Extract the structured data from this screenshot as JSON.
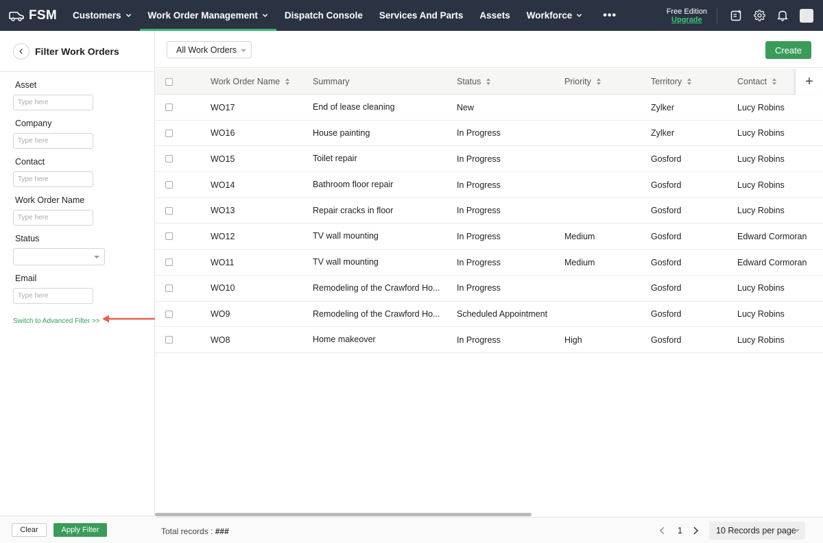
{
  "brand": {
    "name": "FSM"
  },
  "nav": {
    "items": [
      {
        "label": "Customers",
        "dropdown": true,
        "active": false
      },
      {
        "label": "Work Order Management",
        "dropdown": true,
        "active": true
      },
      {
        "label": "Dispatch Console",
        "dropdown": false,
        "active": false
      },
      {
        "label": "Services And Parts",
        "dropdown": false,
        "active": false
      },
      {
        "label": "Assets",
        "dropdown": false,
        "active": false
      },
      {
        "label": "Workforce",
        "dropdown": true,
        "active": false
      }
    ],
    "more": "•••",
    "edition": "Free Edition",
    "upgrade": "Upgrade",
    "icons": [
      "add-note-icon",
      "gear-icon",
      "bell-icon",
      "avatar"
    ]
  },
  "filter": {
    "title": "Filter Work Orders",
    "fields": [
      {
        "label": "Asset",
        "placeholder": "Type here",
        "type": "text"
      },
      {
        "label": "Company",
        "placeholder": "Type here",
        "type": "text"
      },
      {
        "label": "Contact",
        "placeholder": "Type here",
        "type": "text"
      },
      {
        "label": "Work Order Name",
        "placeholder": "Type here",
        "type": "text"
      },
      {
        "label": "Status",
        "placeholder": "",
        "type": "select"
      },
      {
        "label": "Email",
        "placeholder": "Type here",
        "type": "text"
      }
    ],
    "advanced_link": "Switch to Advanced Filter >>",
    "clear_label": "Clear",
    "apply_label": "Apply Filter"
  },
  "toolbar": {
    "view": "All Work Orders",
    "create_label": "Create"
  },
  "table": {
    "columns": [
      "Work Order Name",
      "Summary",
      "Status",
      "Priority",
      "Territory",
      "Contact"
    ],
    "rows": [
      [
        "WO17",
        "End of lease cleaning",
        "New",
        "",
        "Zylker",
        "Lucy Robins"
      ],
      [
        "WO16",
        "House painting",
        "In Progress",
        "",
        "Zylker",
        "Lucy Robins"
      ],
      [
        "WO15",
        "Toilet repair",
        "In Progress",
        "",
        "Gosford",
        "Lucy Robins"
      ],
      [
        "WO14",
        "Bathroom floor repair",
        "In Progress",
        "",
        "Gosford",
        "Lucy Robins"
      ],
      [
        "WO13",
        "Repair cracks in floor",
        "In Progress",
        "",
        "Gosford",
        "Lucy Robins"
      ],
      [
        "WO12",
        "TV wall mounting",
        "In Progress",
        "Medium",
        "Gosford",
        "Edward Cormoran"
      ],
      [
        "WO11",
        "TV wall mounting",
        "In Progress",
        "Medium",
        "Gosford",
        "Edward Cormoran"
      ],
      [
        "WO10",
        "Remodeling of the Crawford Ho...",
        "In Progress",
        "",
        "Gosford",
        "Lucy Robins"
      ],
      [
        "WO9",
        "Remodeling of the Crawford Ho...",
        "Scheduled Appointment",
        "",
        "Gosford",
        "Lucy Robins"
      ],
      [
        "WO8",
        "Home makeover",
        "In Progress",
        "High",
        "Gosford",
        "Lucy Robins"
      ]
    ]
  },
  "footer": {
    "total_label": "Total records :",
    "total_value": "###",
    "page": "1",
    "per_page": "10 Records per page"
  },
  "colors": {
    "nav_bg": "#2b3343",
    "accent": "#3b9c5a",
    "annotation_arrow": "#e8614f"
  }
}
